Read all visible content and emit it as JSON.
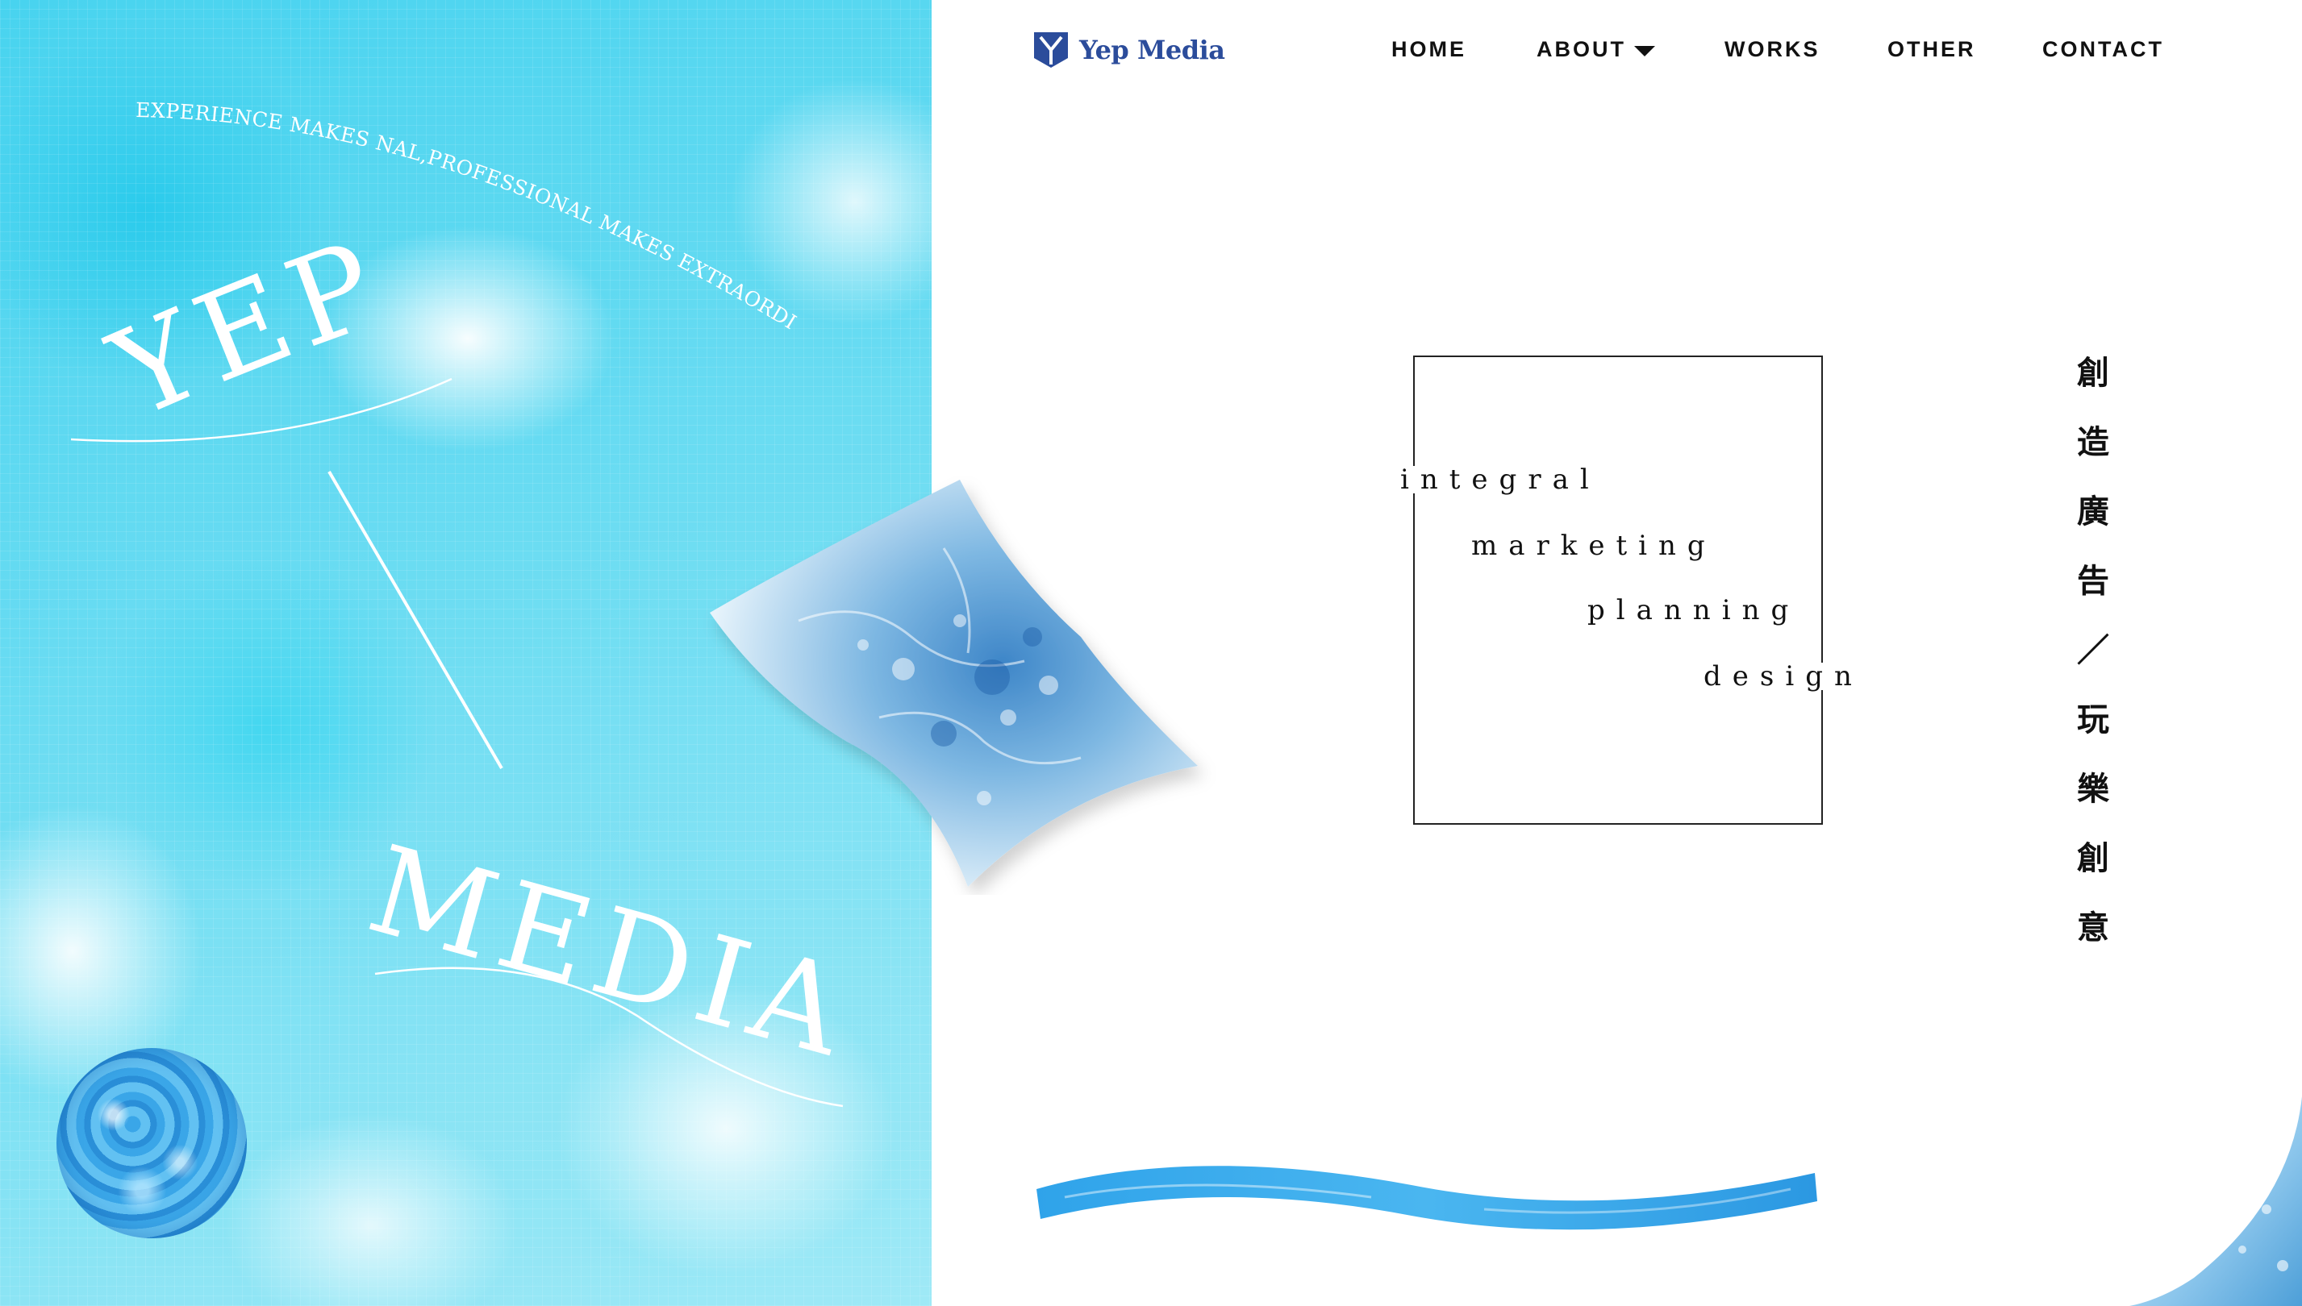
{
  "hero": {
    "tagline": "EXPERIENCE MAKES NAL,PROFESSIONAL MAKES EXTRAORDINARY.",
    "word_top": "YEP",
    "word_bottom": "MEDIA"
  },
  "header": {
    "logo_text": "Yep Media",
    "nav": [
      {
        "label": "HOME"
      },
      {
        "label": "ABOUT"
      },
      {
        "label": "WORKS"
      },
      {
        "label": "OTHER"
      },
      {
        "label": "CONTACT"
      }
    ]
  },
  "frame": {
    "lines": [
      "integral",
      "marketing",
      "planning",
      "design"
    ]
  },
  "slogan": {
    "chars": [
      "創",
      "造",
      "廣",
      "告",
      "／",
      "玩",
      "樂",
      "創",
      "意"
    ]
  },
  "colors": {
    "logo_blue": "#2b4c9b",
    "hero_cyan": "#48d3ef",
    "water_blue": "#2f9fe4"
  },
  "icons": {
    "logo": "y-shield-logo-icon",
    "about_caret": "caret-down-icon"
  }
}
